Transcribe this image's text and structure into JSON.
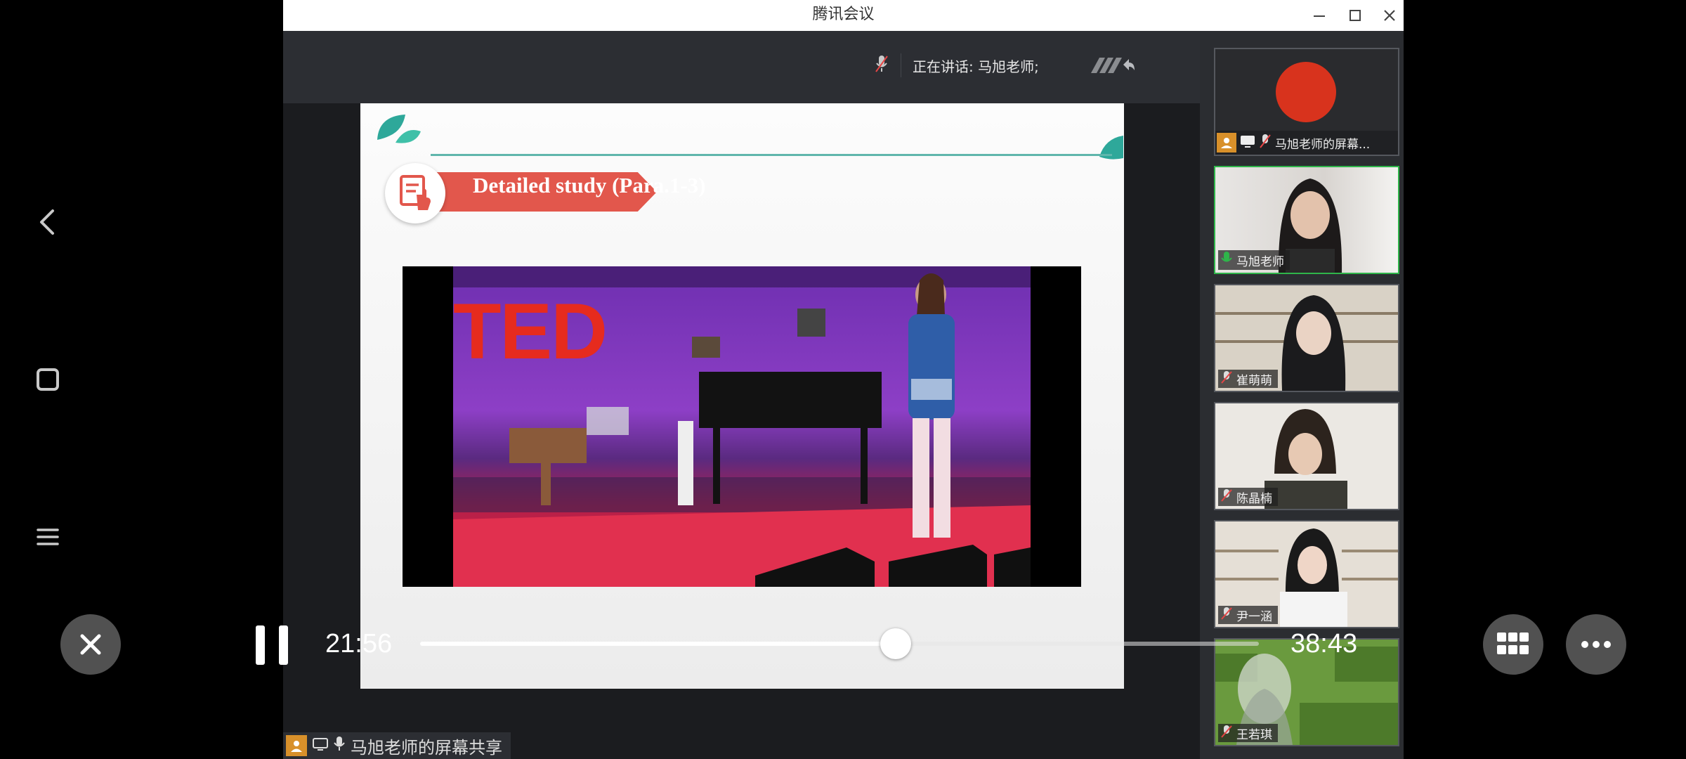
{
  "window": {
    "title": "腾讯会议"
  },
  "meeting": {
    "speaking_label": "正在讲话: 马旭老师;"
  },
  "slide": {
    "heading": "Detailed study (Para.1-3)",
    "video_logo": "TED"
  },
  "share_label": "马旭老师的屏幕共享",
  "participants": [
    {
      "name": "马旭老师的屏幕...",
      "avatar_color": "#d8331d"
    },
    {
      "name": "马旭老师",
      "speaking": true
    },
    {
      "name": "崔萌萌"
    },
    {
      "name": "陈晶楠"
    },
    {
      "name": "尹一涵"
    },
    {
      "name": "王若琪"
    }
  ],
  "player": {
    "current_time": "21:56",
    "total_time": "38:43",
    "progress": 0.567
  },
  "colors": {
    "accent_red": "#e2574c",
    "speaking_green": "#2fb54a",
    "teal": "#2ea89a"
  },
  "icons": [
    "back-icon",
    "home-icon",
    "menu-icon",
    "close-icon",
    "pause-icon",
    "grid-icon",
    "more-icon"
  ]
}
